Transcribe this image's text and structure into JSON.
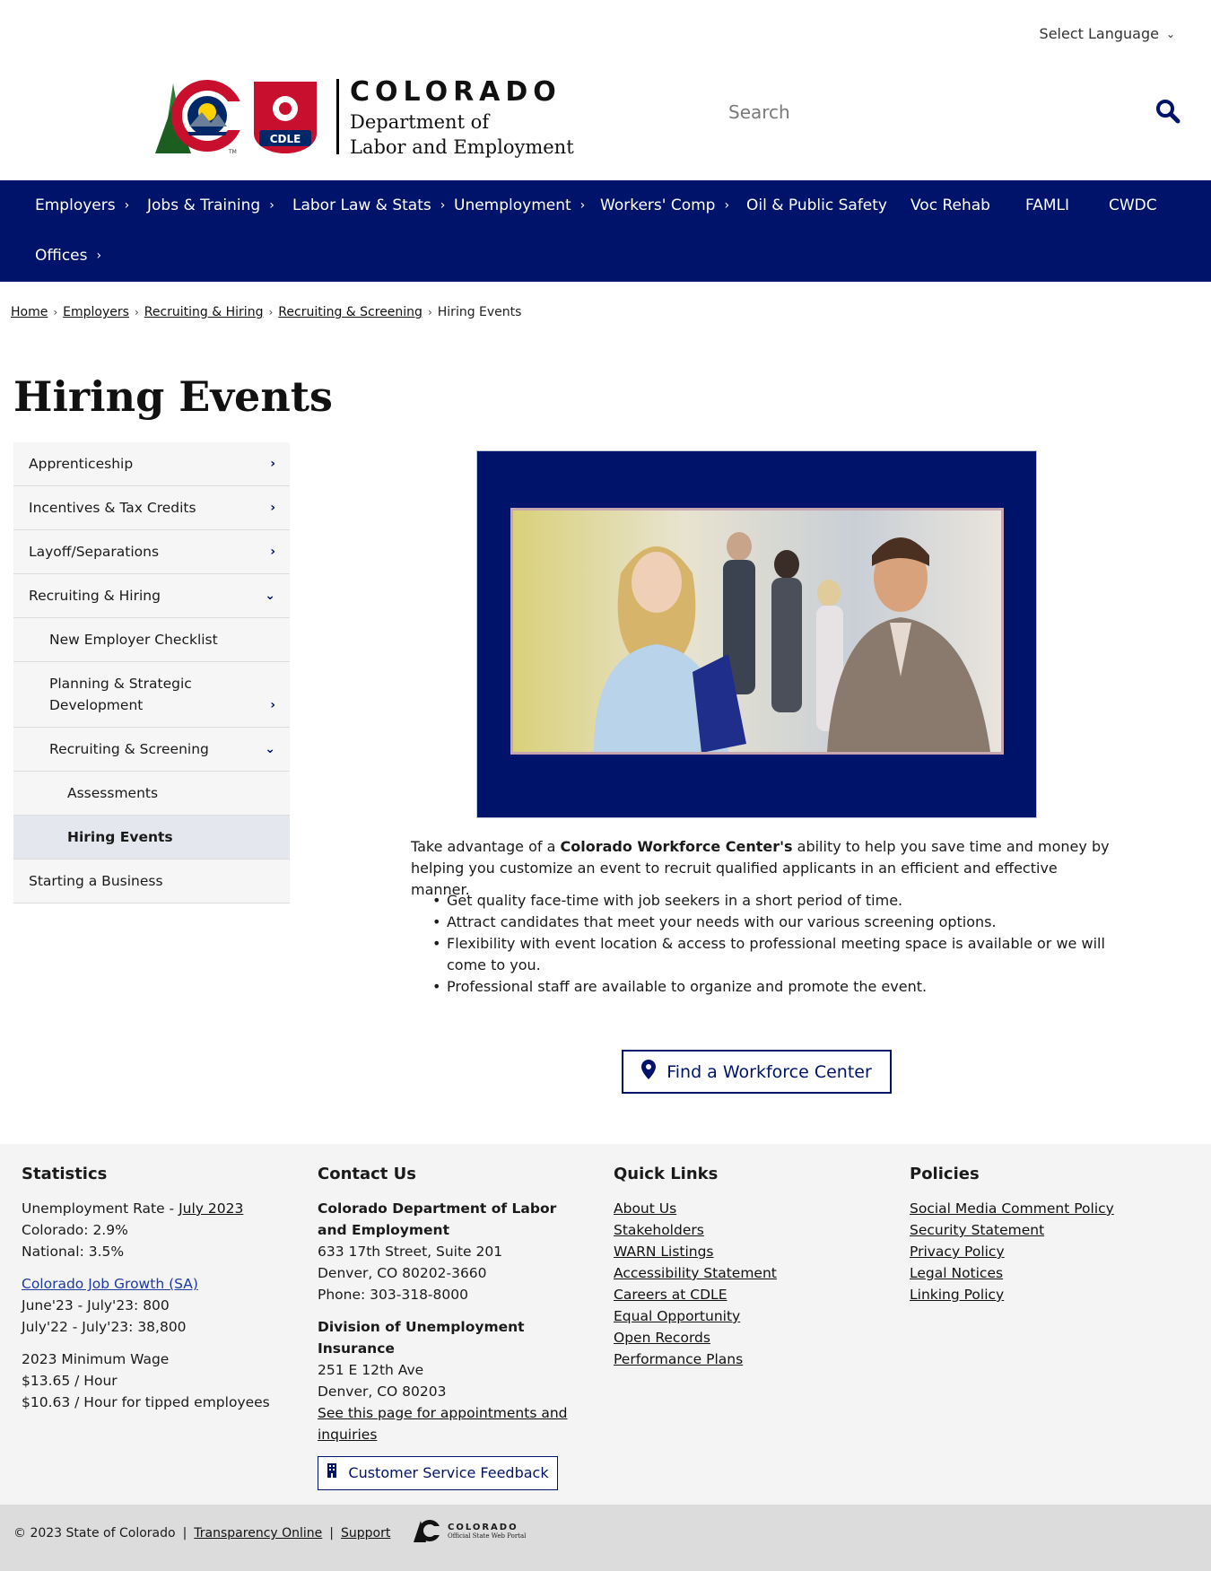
{
  "language": {
    "label": "Select Language"
  },
  "logo": {
    "state": "COLORADO",
    "dept_line1": "Department of",
    "dept_line2": "Labor and Employment",
    "badge": "CDLE",
    "tm": "TM"
  },
  "search": {
    "placeholder": "Search"
  },
  "nav": {
    "items": [
      {
        "label": "Employers"
      },
      {
        "label": "Jobs & Training"
      },
      {
        "label": "Labor Law & Stats"
      },
      {
        "label": "Unemployment"
      },
      {
        "label": "Workers' Comp"
      },
      {
        "label": "Oil & Public Safety"
      },
      {
        "label": "Voc Rehab"
      },
      {
        "label": "FAMLI"
      },
      {
        "label": "CWDC"
      },
      {
        "label": "Offices"
      }
    ]
  },
  "breadcrumb": [
    "Home",
    "Employers",
    "Recruiting & Hiring",
    "Recruiting & Screening",
    "Hiring Events"
  ],
  "page_title": "Hiring Events",
  "sidebar": {
    "items": [
      {
        "label": "Apprenticeship"
      },
      {
        "label": "Incentives & Tax Credits"
      },
      {
        "label": "Layoff/Separations"
      },
      {
        "label": "Recruiting & Hiring"
      },
      {
        "label": "New Employer Checklist"
      },
      {
        "label": "Planning & Strategic Development"
      },
      {
        "label": "Recruiting & Screening"
      },
      {
        "label": "Assessments"
      },
      {
        "label": "Hiring Events"
      },
      {
        "label": "Starting a Business"
      }
    ]
  },
  "main": {
    "intro_before": "Take advantage of a ",
    "intro_bold": "Colorado Workforce Center's",
    "intro_after": " ability to help you save time and money by helping you customize an event to recruit qualified applicants in an efficient and effective manner.",
    "bullets": [
      "Get quality face-time with job seekers in a short period of time.",
      "Attract candidates that meet your needs with our various screening options.",
      "Flexibility with event location & access to professional meeting space is available or we will come to you.",
      "Professional staff are available to organize and promote the event."
    ],
    "workforce_button": "Find a Workforce Center"
  },
  "footer": {
    "statistics": {
      "heading": "Statistics",
      "unemp_prefix": "Unemployment Rate - ",
      "unemp_link": "July 2023",
      "colorado": "Colorado: 2.9%",
      "national": "National: 3.5%",
      "growth_link": "Colorado Job Growth (SA)",
      "growth1": "June'23 - July'23: 800",
      "growth2": "July'22 - July'23: 38,800",
      "wage_title": "2023 Minimum Wage",
      "wage1": "$13.65 / Hour",
      "wage2": "$10.63 / Hour for tipped employees"
    },
    "contact": {
      "heading": "Contact Us",
      "org": "Colorado Department of Labor and Employment",
      "addr1": "633 17th Street, Suite 201",
      "addr2": "Denver, CO  80202-3660",
      "phone": "Phone: 303-318-8000",
      "div": "Division of Unemployment Insurance",
      "div_addr1": "251 E 12th Ave",
      "div_addr2": "Denver, CO  80203",
      "appt_link": "See this page for appointments and inquiries",
      "feedback_button": "Customer Service Feedback"
    },
    "quick_links": {
      "heading": "Quick Links",
      "links": [
        "About Us",
        "Stakeholders",
        "WARN Listings",
        "Accessibility Statement",
        "Careers at CDLE",
        "Equal Opportunity",
        "Open Records",
        "Performance Plans"
      ]
    },
    "policies": {
      "heading": "Policies",
      "links": [
        "Social Media Comment Policy",
        "Security Statement",
        "Privacy Policy",
        "Legal Notices",
        "Linking Policy"
      ]
    }
  },
  "subfooter": {
    "copyright": "© 2023 State of Colorado",
    "sep": "|",
    "transparency": "Transparency Online",
    "support": "Support",
    "portal_title": "COLORADO",
    "portal_sub": "Official State Web Portal"
  },
  "colors": {
    "navy": "#00136b",
    "footer_bg": "#f4f4f4",
    "link_blue": "#1f3ba0"
  },
  "icons": [
    "chevron-down-icon",
    "search-icon",
    "chevron-right-icon",
    "map-pin-icon",
    "building-icon"
  ]
}
